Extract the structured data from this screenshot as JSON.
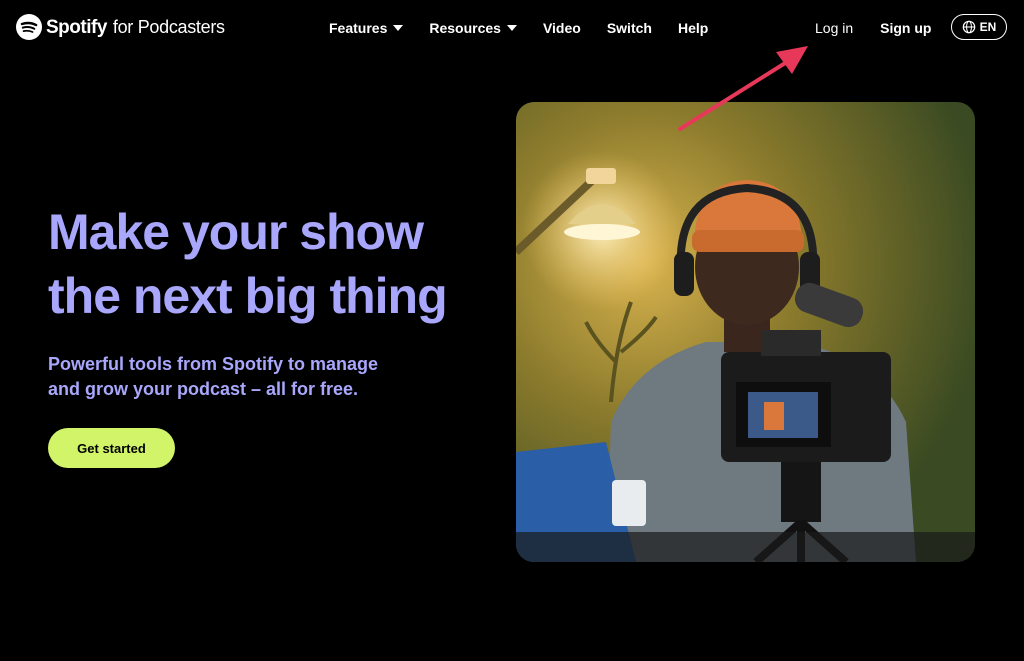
{
  "brand": {
    "name": "Spotify",
    "suffix": "for Podcasters",
    "logo_color": "#ffffff"
  },
  "nav": {
    "items": [
      {
        "label": "Features",
        "has_dropdown": true
      },
      {
        "label": "Resources",
        "has_dropdown": true
      },
      {
        "label": "Video",
        "has_dropdown": false
      },
      {
        "label": "Switch",
        "has_dropdown": false
      },
      {
        "label": "Help",
        "has_dropdown": false
      }
    ]
  },
  "auth": {
    "login_label": "Log in",
    "signup_label": "Sign up"
  },
  "language": {
    "code": "EN",
    "icon": "globe-icon"
  },
  "hero": {
    "headline_line1": "Make your show",
    "headline_line2": "the next big thing",
    "subhead_line1": "Powerful tools from Spotify to manage",
    "subhead_line2": "and grow your podcast – all for free.",
    "cta_label": "Get started",
    "image": "podcaster-with-headphones-and-camera"
  },
  "colors": {
    "background": "#000000",
    "accent_text": "#a9a7fb",
    "cta_background": "#d2f469",
    "annotation_arrow": "#e8385a"
  }
}
